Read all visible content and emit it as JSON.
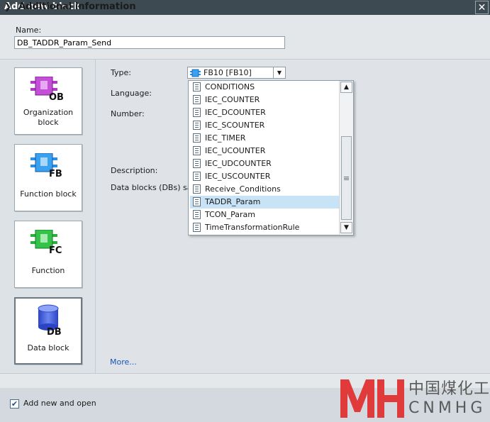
{
  "window": {
    "title": "Add new block",
    "close_icon": "close-icon"
  },
  "name": {
    "label": "Name:",
    "value": "DB_TADDR_Param_Send"
  },
  "block_types": [
    {
      "label": "Organization block",
      "icon_text": "OB",
      "color": "#b236c8"
    },
    {
      "label": "Function block",
      "icon_text": "FB",
      "color": "#2a8fe6"
    },
    {
      "label": "Function",
      "icon_text": "FC",
      "color": "#27b23b"
    },
    {
      "label": "Data block",
      "icon_text": "DB",
      "color": "#3b5fd9"
    }
  ],
  "form": {
    "type_label": "Type:",
    "type_value": "FB10  [FB10]",
    "language_label": "Language:",
    "number_label": "Number:",
    "description_label": "Description:",
    "description_text": "Data blocks (DBs) sa",
    "more_link": "More..."
  },
  "dropdown": {
    "items": [
      "CONDITIONS",
      "IEC_COUNTER",
      "IEC_DCOUNTER",
      "IEC_SCOUNTER",
      "IEC_TIMER",
      "IEC_UCOUNTER",
      "IEC_UDCOUNTER",
      "IEC_USCOUNTER",
      "Receive_Conditions",
      "TADDR_Param",
      "TCON_Param",
      "TimeTransformationRule"
    ],
    "selected": "TADDR_Param"
  },
  "additional": {
    "label": "Additional  information"
  },
  "footer": {
    "checkbox_label": "Add new and open",
    "checked": true
  },
  "watermark": {
    "chinese": "中国煤化工",
    "latin": "CNMHG"
  }
}
